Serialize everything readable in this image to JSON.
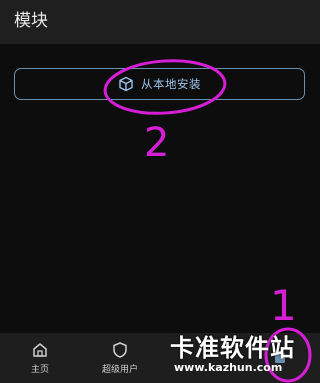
{
  "appbar": {
    "title": "模块"
  },
  "main": {
    "install_button_label": "从本地安装",
    "install_icon": "package-box-icon"
  },
  "annotations": {
    "marker_1": "1",
    "marker_2": "2",
    "color": "#d61ed6"
  },
  "bottom_nav": {
    "items": [
      {
        "label": "主页",
        "icon": "home-icon"
      },
      {
        "label": "超级用户",
        "icon": "shield-icon"
      },
      {
        "label": "",
        "icon": ""
      },
      {
        "label": "",
        "icon": "puzzle-icon"
      }
    ]
  },
  "watermark": {
    "text": "卡准软件站",
    "url": "www.kazhun.com"
  },
  "colors": {
    "accent": "#9cc4ea",
    "background": "#0d0d0d",
    "appbar": "#1f1f1f"
  }
}
